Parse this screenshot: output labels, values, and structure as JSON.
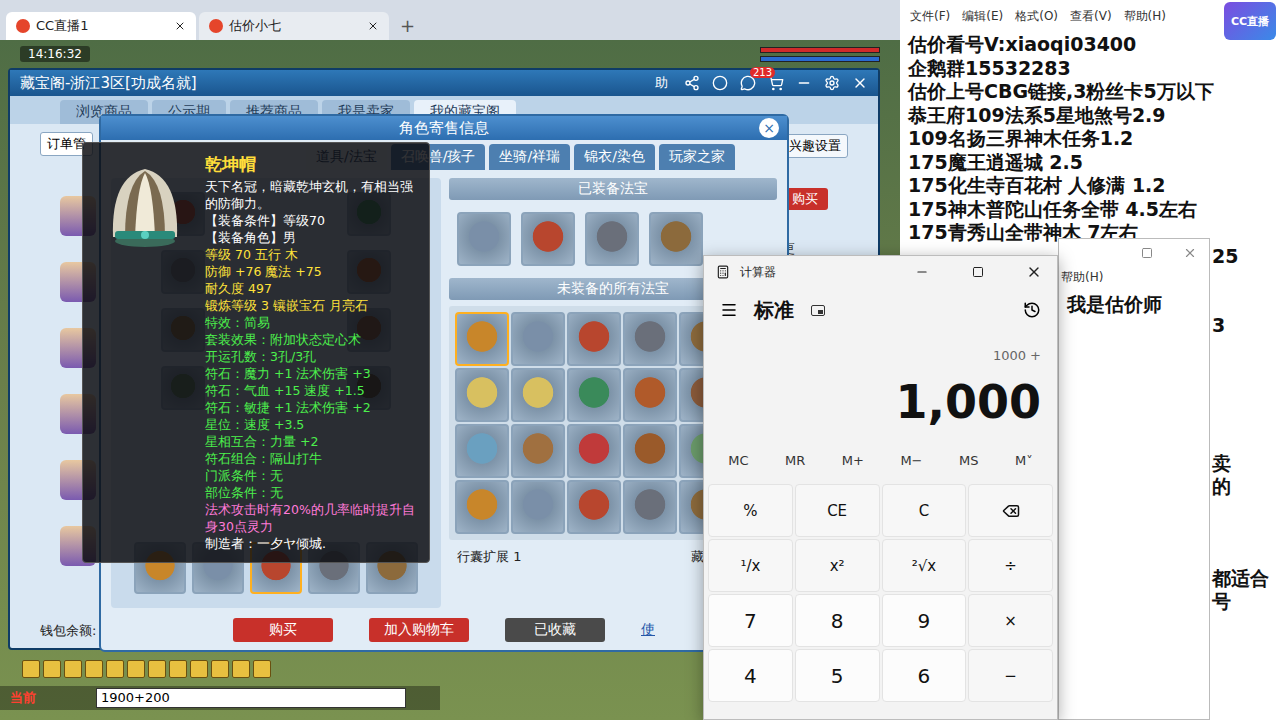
{
  "browser": {
    "tabs": [
      {
        "label": "CC直播1",
        "selected": true
      },
      {
        "label": "估价小七",
        "selected": false
      }
    ],
    "new_tab": "+"
  },
  "game": {
    "clock": "14:16:32",
    "chat": {
      "channel": "当前",
      "input": "1900+200"
    }
  },
  "cbg": {
    "title": "藏宝阁-浙江3区[功成名就]",
    "help": "助",
    "messages": "213",
    "nav": [
      {
        "label": "浏览商品",
        "selected": false
      },
      {
        "label": "公示期",
        "selected": false
      },
      {
        "label": "推荐商品",
        "selected": false
      },
      {
        "label": "我是卖家",
        "selected": false
      },
      {
        "label": "我的藏宝阁",
        "selected": true
      }
    ],
    "order_button": "订单管",
    "interest_button": "兴趣设置",
    "buy_button": "购买",
    "more": "更",
    "wallet": "钱包余额:"
  },
  "dialog": {
    "title": "角色寄售信息",
    "close": "×",
    "tabs": [
      {
        "label": "道具/法宝",
        "selected": true
      },
      {
        "label": "召唤兽/孩子",
        "selected": false
      },
      {
        "label": "坐骑/祥瑞",
        "selected": false
      },
      {
        "label": "锦衣/染色",
        "selected": false
      },
      {
        "label": "玩家之家",
        "selected": false
      }
    ],
    "equipment_row": [
      {
        "selected": false
      },
      {
        "selected": false
      },
      {
        "selected": true
      },
      {
        "selected": false
      },
      {
        "selected": false
      }
    ],
    "equipped_title": "已装备法宝",
    "unequipped_title": "未装备的所有法宝",
    "fabao": [
      {
        "selected": true
      },
      {
        "selected": false
      },
      {
        "selected": false
      },
      {
        "selected": false
      },
      {
        "selected": false
      },
      {
        "selected": false
      },
      {
        "selected": false
      },
      {
        "selected": false
      },
      {
        "selected": false
      },
      {
        "selected": false
      },
      {
        "selected": false
      },
      {
        "selected": false
      },
      {
        "selected": false
      },
      {
        "selected": false
      },
      {
        "selected": false
      },
      {
        "selected": false
      },
      {
        "selected": false
      },
      {
        "selected": false
      },
      {
        "selected": false
      },
      {
        "selected": false
      },
      {
        "selected": false
      },
      {
        "selected": false
      },
      {
        "selected": false
      },
      {
        "selected": false
      }
    ],
    "bag_label": "行囊扩展",
    "bag_count": "1",
    "showcase": "藏宝阁展示位",
    "buttons": [
      {
        "label": "购买",
        "kind": "red"
      },
      {
        "label": "加入购物车",
        "kind": "red"
      },
      {
        "label": "已收藏",
        "kind": "dark"
      }
    ],
    "link": "使"
  },
  "tooltip": {
    "name": "乾坤帽",
    "lines": [
      {
        "text": "天下名冠，暗藏乾坤玄机，有相当强的防御力。",
        "kind": "desc"
      },
      {
        "text": "【装备条件】等级70",
        "kind": "desc"
      },
      {
        "text": "【装备角色】男",
        "kind": "desc"
      },
      {
        "text": "等级 70  五行 木",
        "kind": "base"
      },
      {
        "text": "防御 +76 魔法 +75",
        "kind": "base"
      },
      {
        "text": "耐久度 497",
        "kind": "base"
      },
      {
        "text": "锻炼等级 3  镶嵌宝石 月亮石",
        "kind": "base"
      },
      {
        "text": "特效：简易",
        "kind": "attr"
      },
      {
        "text": "套装效果：附加状态定心术",
        "kind": "attr"
      },
      {
        "text": "开运孔数：3孔/3孔",
        "kind": "attr"
      },
      {
        "text": "符石：魔力 +1 法术伤害 +3",
        "kind": "attr"
      },
      {
        "text": "符石：气血 +15 速度 +1.5",
        "kind": "attr"
      },
      {
        "text": "符石：敏捷 +1 法术伤害 +2",
        "kind": "attr"
      },
      {
        "text": "星位：速度 +3.5",
        "kind": "attr"
      },
      {
        "text": "星相互合：力量 +2",
        "kind": "attr"
      },
      {
        "text": "符石组合：隔山打牛",
        "kind": "attr"
      },
      {
        "text": "门派条件：无",
        "kind": "attr"
      },
      {
        "text": "部位条件：无",
        "kind": "attr"
      },
      {
        "text": "法术攻击时有20%的几率临时提升自身30点灵力",
        "kind": "effect"
      },
      {
        "text": "制造者：一夕ヤ倾城.",
        "kind": "desc"
      }
    ]
  },
  "notepad": {
    "menu": [
      "文件(F)",
      "编辑(E)",
      "格式(O)",
      "查看(V)",
      "帮助(H)"
    ],
    "lines": [
      "估价看号V:xiaoqi03400",
      "企鹅群15532283",
      "估价上号CBG链接,3粉丝卡5万以下",
      "恭王府109法系5星地煞号2.9",
      "109名扬三界神木任务1.2",
      "175魔王逍遥城 2.5",
      "175化生寺百花村 人修满 1.2",
      "175神木普陀山任务全带 4.5左右",
      "175青秀山全带神木  7左右"
    ],
    "tails": [
      "25",
      "3",
      "卖",
      "的",
      "都适合",
      "号"
    ]
  },
  "result_window": {
    "menu": "帮助(H)",
    "text": "我是估价师"
  },
  "calculator": {
    "title": "计算器",
    "mode": "标准",
    "expression": "1000 +",
    "value": "1,000",
    "memory": [
      {
        "label": "MC",
        "disabled": false
      },
      {
        "label": "MR",
        "disabled": false
      },
      {
        "label": "M+",
        "disabled": false
      },
      {
        "label": "M−",
        "disabled": false
      },
      {
        "label": "MS",
        "disabled": false
      },
      {
        "label": "M˅",
        "disabled": false
      }
    ],
    "keys": [
      {
        "label": "%",
        "kind": "op"
      },
      {
        "label": "CE",
        "kind": "op"
      },
      {
        "label": "C",
        "kind": "op"
      },
      {
        "kind": "backspace"
      },
      {
        "label": "¹/x",
        "kind": "op"
      },
      {
        "label": "x²",
        "kind": "op"
      },
      {
        "label": "²√x",
        "kind": "op"
      },
      {
        "label": "÷",
        "kind": "op"
      },
      {
        "label": "7",
        "kind": "num"
      },
      {
        "label": "8",
        "kind": "num"
      },
      {
        "label": "9",
        "kind": "num"
      },
      {
        "label": "×",
        "kind": "op"
      },
      {
        "label": "4",
        "kind": "num"
      },
      {
        "label": "5",
        "kind": "num"
      },
      {
        "label": "6",
        "kind": "num"
      },
      {
        "label": "−",
        "kind": "op"
      }
    ]
  },
  "logo": {
    "label": "CC直播"
  }
}
